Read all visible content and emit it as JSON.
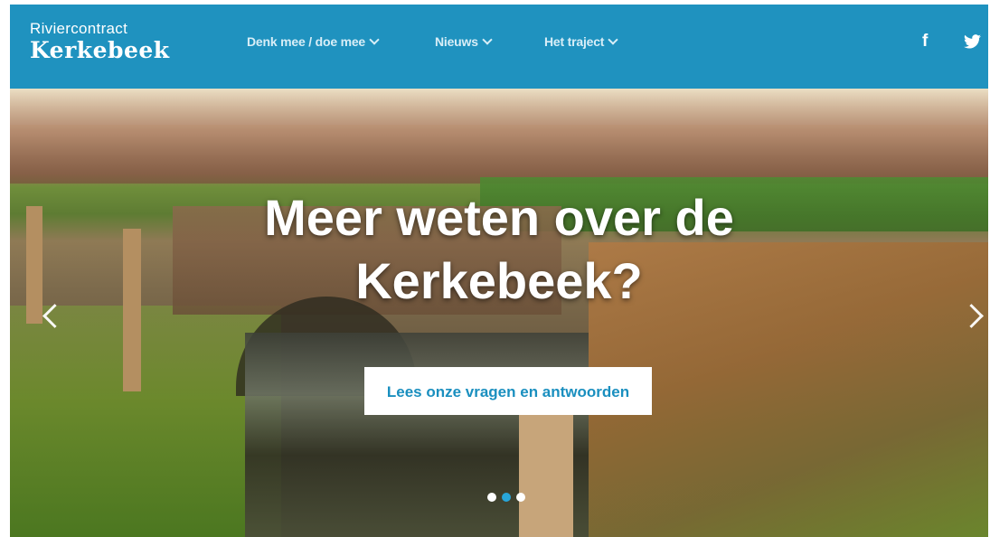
{
  "brand": {
    "top": "Riviercontract",
    "main": "Kerkebeek"
  },
  "nav": {
    "items": [
      {
        "label": "Denk mee / doe mee"
      },
      {
        "label": "Nieuws"
      },
      {
        "label": "Het traject"
      }
    ]
  },
  "social": {
    "facebook": "f"
  },
  "hero": {
    "title_line1": "Meer weten over de",
    "title_line2": "Kerkebeek?",
    "cta_label": "Lees onze vragen en antwoorden",
    "slides_total": 3,
    "active_slide": 2
  },
  "colors": {
    "header_bg": "#1f92bf",
    "cta_text": "#1a8fbf",
    "active_dot": "#28a6d9"
  },
  "icons": [
    "chevron-down-icon",
    "facebook-icon",
    "twitter-icon",
    "chevron-left-icon",
    "chevron-right-icon"
  ]
}
